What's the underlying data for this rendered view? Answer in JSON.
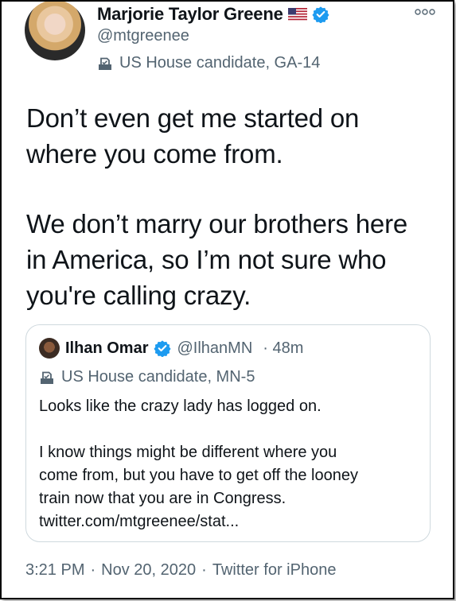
{
  "author": {
    "name": "Marjorie Taylor Greene",
    "handle": "@mtgreenee",
    "label": "US House candidate, GA-14"
  },
  "tweet": {
    "lines": [
      "Don’t even get me started on",
      "where you come from.",
      "We don’t marry our brothers here",
      "in America, so I’m not sure who",
      "you're calling crazy."
    ]
  },
  "quoted": {
    "name": "Ilhan Omar",
    "handle": "@IlhanMN",
    "time": "· 48m",
    "label": "US House candidate, MN-5",
    "lines": [
      "Looks like the crazy lady has logged on.",
      "I know things might be different where you",
      "come from, but you have to get off the looney",
      "train now that you are in Congress.",
      "twitter.com/mtgreenee/stat..."
    ]
  },
  "meta": {
    "time": "3:21 PM",
    "sep1": "·",
    "date": "Nov 20, 2020",
    "sep2": "·",
    "source": "Twitter for iPhone"
  },
  "icons": {
    "verified": "verified-badge-icon",
    "flag": "us-flag-icon",
    "label": "ballot-box-icon",
    "more": "more-icon"
  },
  "colors": {
    "verified": "#1d9bf0",
    "secondary": "#536471",
    "primary": "#0f1419",
    "border": "#cfd9de"
  }
}
